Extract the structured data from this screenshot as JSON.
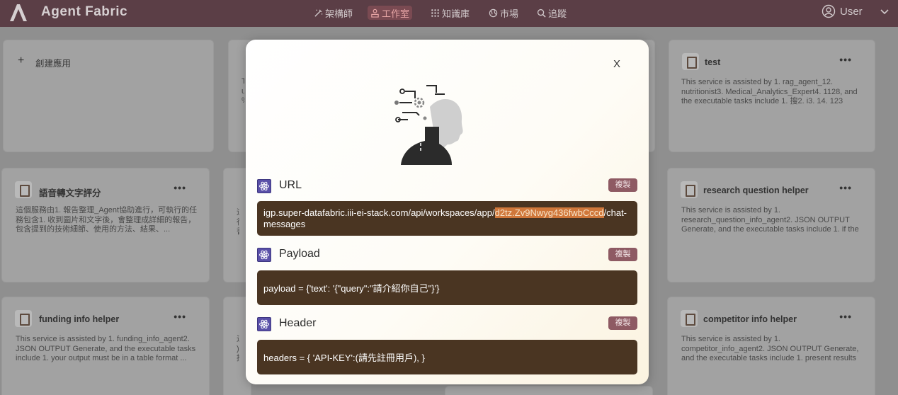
{
  "app": {
    "name": "Agent Fabric"
  },
  "nav": [
    {
      "label": "架構師",
      "icon": "wand-icon"
    },
    {
      "label": "工作室",
      "icon": "studio-icon",
      "active": true
    },
    {
      "label": "知識庫",
      "icon": "grid-icon"
    },
    {
      "label": "市場",
      "icon": "globe-icon"
    },
    {
      "label": "追蹤",
      "icon": "magnifier-icon"
    }
  ],
  "user": {
    "label": "User"
  },
  "create": {
    "label": "創建應用"
  },
  "cards": [
    {
      "title": "test",
      "desc": "This service is assisted by 1. rag_agent_12. nutritionist3. Medical_Analytics_Expert4. 1128, and the executable tasks include 1. 搜2. i3. 14. 123"
    },
    {
      "title": "語音轉文字評分",
      "desc": "這個服務由1. 報告整理_Agent協助進行，可執行的任務包含1. 收到圖片和文字後，會整理成詳細的報告，包含提到的技術細節、使用的方法、結果、..."
    },
    {
      "title": "research question helper",
      "desc": "This service is assisted by 1. research_question_info_agent2. JSON OUTPUT Generate, and the executable tasks include 1. if the input is not a compa..."
    },
    {
      "title": "funding info helper",
      "desc": "This service is assisted by 1. funding_info_agent2. JSON OUTPUT Generate, and the executable tasks include 1. your output must be in a table format ..."
    },
    {
      "title": "competitor info helper",
      "desc": "This service is assisted by 1. competitor_info_agent2. JSON OUTPUT Generate, and the executable tasks include 1. present results in a table format ..."
    }
  ],
  "partial_text": {
    "t1": "T\nu\n%",
    "t2": "這\n行\n書",
    "t3": "這\n), \n攪"
  },
  "card_menu": "•••",
  "modal": {
    "close_label": "X",
    "copy_label": "複製",
    "url": {
      "title": "URL",
      "value_prefix": "igp.super-datafabric.iii-ei-stack.com/api/workspaces/app/",
      "value_highlight": "d2tz.Zv9Nwyg436fwbCccd",
      "value_suffix": "/chat-messages"
    },
    "payload": {
      "title": "Payload",
      "value": "payload = {'text': '{\"query\":\"請介紹你自己\"}'}"
    },
    "header": {
      "title": "Header",
      "value": "headers = { 'API-KEY':(請先註冊用戶), }"
    }
  },
  "colors": {
    "topbar": "#5b3e46",
    "copy_button": "#8e5a63",
    "code_box": "#4a3522",
    "highlight": "#d0773a",
    "section_icon": "#5a50a8"
  }
}
